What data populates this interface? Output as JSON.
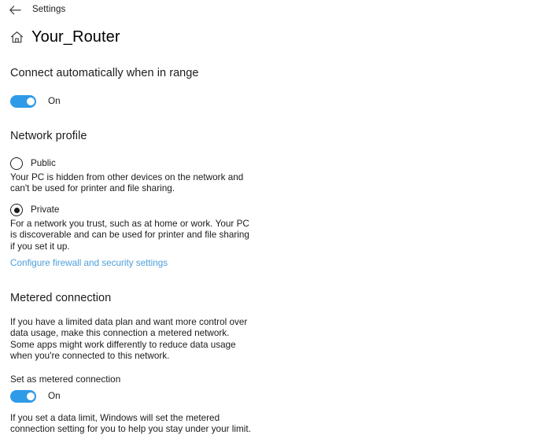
{
  "titlebar": {
    "back_icon": "back-arrow-icon",
    "app_label": "Settings"
  },
  "header": {
    "icon": "home-icon",
    "title": "Your_Router"
  },
  "connect_automatically": {
    "heading": "Connect automatically when in range",
    "toggle_label": "On",
    "toggle_state": "on"
  },
  "network_profile": {
    "heading": "Network profile",
    "options": [
      {
        "label": "Public",
        "selected": false,
        "description": "Your PC is hidden from other devices on the network and can't be used for printer and file sharing."
      },
      {
        "label": "Private",
        "selected": true,
        "description": "For a network you trust, such as at home or work. Your PC is discoverable and can be used for printer and file sharing if you set it up."
      }
    ],
    "link_label": "Configure firewall and security settings"
  },
  "metered_connection": {
    "heading": "Metered connection",
    "description": "If you have a limited data plan and want more control over data usage, make this connection a metered network. Some apps might work differently to reduce data usage when you're connected to this network.",
    "toggle_heading": "Set as metered connection",
    "toggle_label": "On",
    "toggle_state": "on",
    "footer_note": "If you set a data limit, Windows will set the metered connection setting for you to help you stay under your limit."
  },
  "colors": {
    "accent": "#2f9ae8",
    "link": "#4c9ed9",
    "text": "#1b1b1b",
    "background": "#ffffff"
  }
}
